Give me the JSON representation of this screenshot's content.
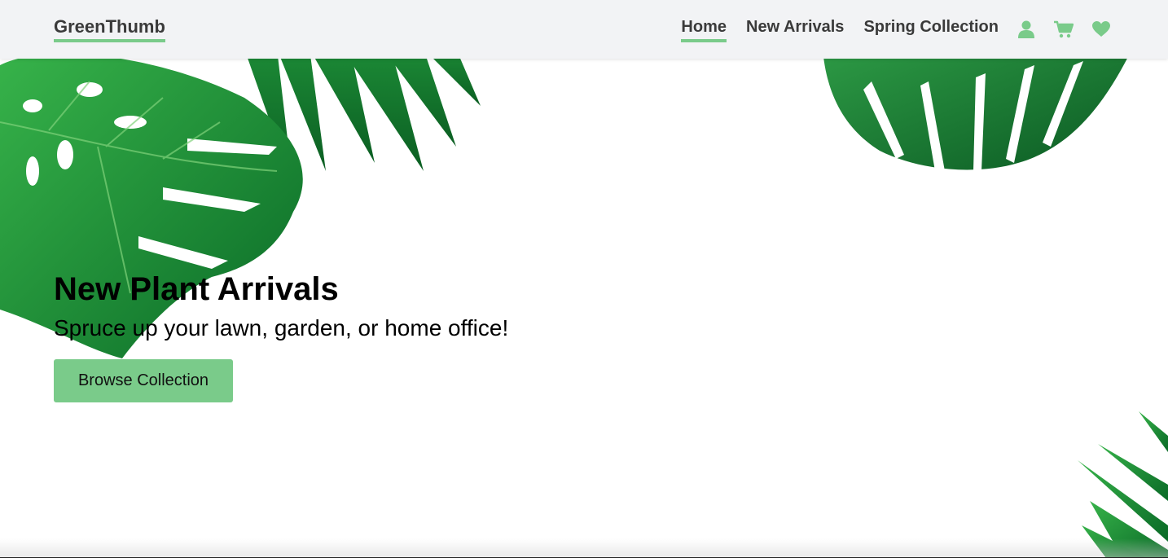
{
  "header": {
    "brand": "GreenThumb",
    "nav": [
      {
        "label": "Home",
        "active": true
      },
      {
        "label": "New Arrivals",
        "active": false
      },
      {
        "label": "Spring Collection",
        "active": false
      }
    ],
    "icons": [
      "user-icon",
      "cart-icon",
      "heart-icon"
    ]
  },
  "hero": {
    "title": "New Plant Arrivals",
    "subtitle": "Spruce up your lawn, garden, or home office!",
    "button_label": "Browse Collection"
  },
  "colors": {
    "accent": "#7acb8a",
    "header_bg": "#f2f3f5",
    "nav_text": "#3a3a3a",
    "leaf_dark": "#0b6b2a",
    "leaf_light": "#2fa24a"
  }
}
